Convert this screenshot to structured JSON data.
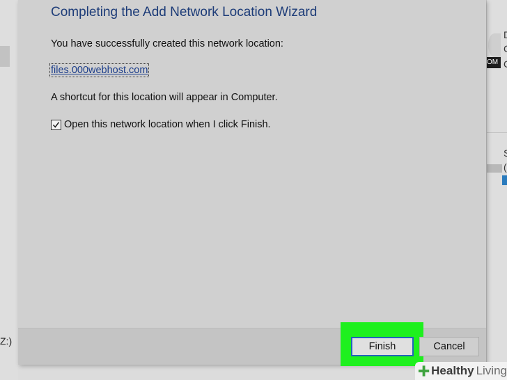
{
  "background": {
    "left_drive_label": "Z:)",
    "right_texts": [
      "D",
      "C",
      "C",
      "S",
      "("
    ],
    "right_logo_text": "OM"
  },
  "wizard": {
    "title": "Completing the Add Network Location Wizard",
    "success_message": "You have successfully created this network location:",
    "location_link": "files.000webhost.com",
    "shortcut_message": "A shortcut for this location will appear in Computer.",
    "open_on_finish": {
      "label": "Open this network location when I click Finish.",
      "checked": true
    },
    "buttons": {
      "finish": "Finish",
      "cancel": "Cancel"
    }
  },
  "highlight_color": "#1ef01e",
  "watermark": {
    "bold": "Healthy",
    "light": "Living"
  }
}
